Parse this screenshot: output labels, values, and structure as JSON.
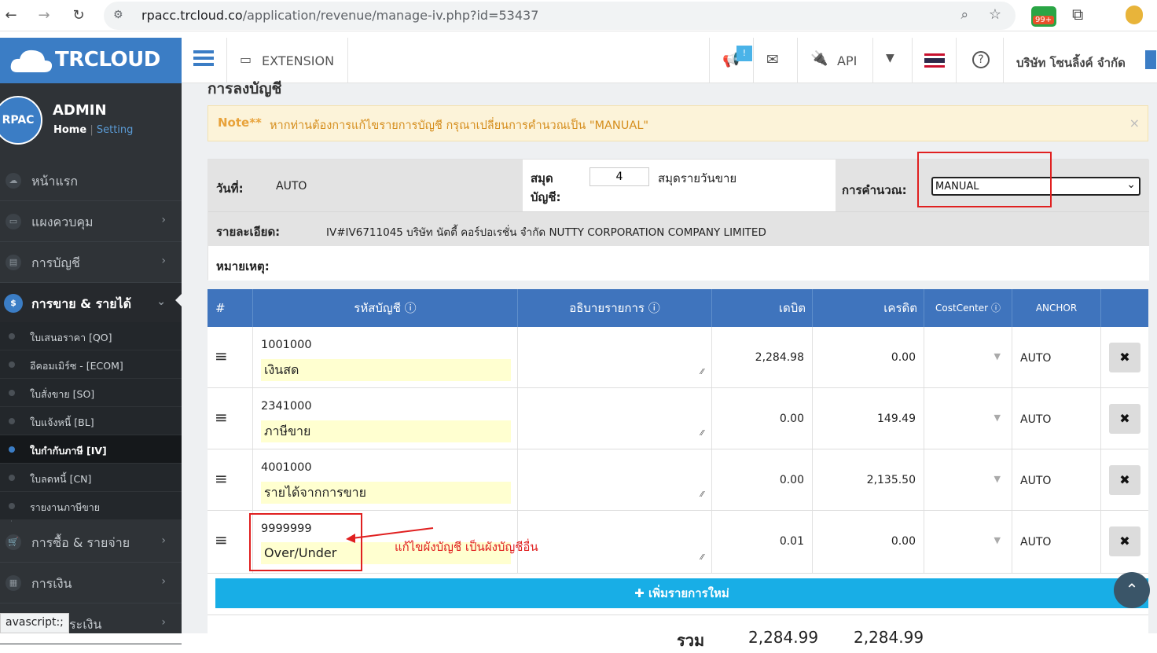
{
  "browser": {
    "url_host": "rpacc.trcloud.co",
    "url_path": "/application/revenue/manage-iv.php?id=53437",
    "ext_badge": "99+"
  },
  "header": {
    "logo": "TRCLOUD",
    "extension_label": "EXTENSION",
    "api_label": "API",
    "notif_badge": "!",
    "company": "บริษัท โซนลิ้งค์ จำกัด"
  },
  "user": {
    "avatar": "RPAC",
    "name": "ADMIN",
    "home": "Home",
    "sep": "|",
    "setting": "Setting"
  },
  "sidebar": {
    "items": [
      {
        "label": "หน้าแรก"
      },
      {
        "label": "แผงควบคุม"
      },
      {
        "label": "การบัญชี"
      },
      {
        "label": "การขาย & รายได้"
      },
      {
        "label": "การซื้อ & รายจ่าย"
      },
      {
        "label": "การเงิน"
      },
      {
        "label": "ระเงิน"
      }
    ],
    "sub": [
      {
        "label": "ใบเสนอราคา [QO]"
      },
      {
        "label": "อีคอมเมิร์ซ - [ECOM]"
      },
      {
        "label": "ใบสั่งขาย [SO]"
      },
      {
        "label": "ใบแจ้งหนี้ [BL]"
      },
      {
        "label": "ใบกำกับภาษี [IV]"
      },
      {
        "label": "ใบลดหนี้ [CN]"
      },
      {
        "label": "รายงานภาษีขาย"
      }
    ],
    "status_tip": "avascript:;"
  },
  "page": {
    "section_title": "การลงบัญชี",
    "note_bold": "Note**",
    "note_text": "หากท่านต้องการแก้ไขรายการบัญชี กรุณาเปลี่ยนการคำนวณเป็น \"MANUAL\"",
    "note_close": "×"
  },
  "form": {
    "date_label": "วันที่:",
    "date_value": "AUTO",
    "book_label1": "สมุด",
    "book_label2": "บัญชี:",
    "book_value": "4",
    "book_name": "สมุดรายวันขาย",
    "calc_label": "การคำนวณ:",
    "calc_value": "MANUAL",
    "detail_label": "รายละเอียด:",
    "detail_value": "IV#IV6711045  บริษัท นัตตี้ คอร์ปอเรชั่น จำกัด NUTTY CORPORATION COMPANY LIMITED",
    "remark_label": "หมายเหตุ:"
  },
  "table": {
    "headers": {
      "hash": "#",
      "account": "รหัสบัญชี",
      "desc": "อธิบายรายการ",
      "debit": "เดบิต",
      "credit": "เครดิต",
      "cc": "CostCenter",
      "anchor": "ANCHOR"
    },
    "rows": [
      {
        "code": "1001000",
        "name": "เงินสด",
        "debit": "2,284.98",
        "credit": "0.00",
        "anchor": "AUTO"
      },
      {
        "code": "2341000",
        "name": "ภาษีขาย",
        "debit": "0.00",
        "credit": "149.49",
        "anchor": "AUTO"
      },
      {
        "code": "4001000",
        "name": "รายได้จากการขาย",
        "debit": "0.00",
        "credit": "2,135.50",
        "anchor": "AUTO"
      },
      {
        "code": "9999999",
        "name": "Over/Under",
        "debit": "0.01",
        "credit": "0.00",
        "anchor": "AUTO"
      }
    ],
    "add_label": "เพิ่มรายการใหม่",
    "total_label": "รวม",
    "total_debit": "2,284.99",
    "total_credit": "2,284.99"
  },
  "annotation": {
    "text": "แก้ไขผังบัญชี เป็นผังบัญชีอื่น",
    "color": "#e02020"
  }
}
